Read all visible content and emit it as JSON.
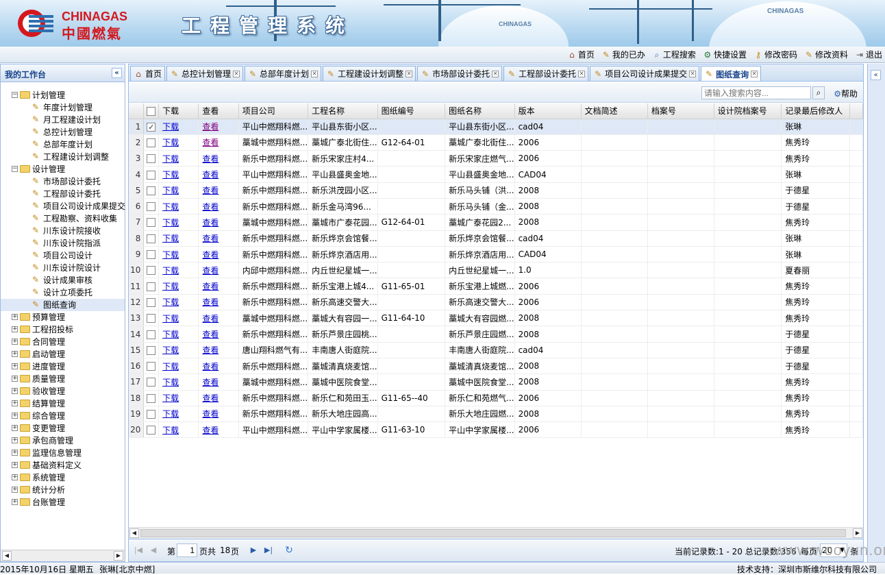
{
  "brand": {
    "logo_en": "CHINAGAS",
    "logo_cn": "中國燃氣",
    "system_title": "工程管理系统",
    "banner_tank_labels": [
      "CHINAGAS",
      "CHINAGAS"
    ]
  },
  "toplinks": [
    {
      "label": "首页",
      "icon": "home-icon"
    },
    {
      "label": "我的已办",
      "icon": "pencil-icon"
    },
    {
      "label": "工程搜索",
      "icon": "search-doc-icon"
    },
    {
      "label": "快捷设置",
      "icon": "gear-icon"
    },
    {
      "label": "修改密码",
      "icon": "key-icon"
    },
    {
      "label": "修改资料",
      "icon": "pencil-icon"
    },
    {
      "label": "退出",
      "icon": "exit-icon"
    }
  ],
  "sidebar": {
    "title": "我的工作台",
    "tree": [
      {
        "label": "计划管理",
        "type": "folder",
        "expanded": true,
        "level": 0
      },
      {
        "label": "年度计划管理",
        "type": "leaf",
        "level": 1
      },
      {
        "label": "月工程建设计划",
        "type": "leaf",
        "level": 1
      },
      {
        "label": "总控计划管理",
        "type": "leaf",
        "level": 1
      },
      {
        "label": "总部年度计划",
        "type": "leaf",
        "level": 1
      },
      {
        "label": "工程建设计划调整",
        "type": "leaf",
        "level": 1
      },
      {
        "label": "设计管理",
        "type": "folder",
        "expanded": true,
        "level": 0
      },
      {
        "label": "市场部设计委托",
        "type": "leaf",
        "level": 1
      },
      {
        "label": "工程部设计委托",
        "type": "leaf",
        "level": 1
      },
      {
        "label": "项目公司设计成果提交",
        "type": "leaf",
        "level": 1
      },
      {
        "label": "工程勘察、资料收集",
        "type": "leaf",
        "level": 1
      },
      {
        "label": "川东设计院接收",
        "type": "leaf",
        "level": 1
      },
      {
        "label": "川东设计院指派",
        "type": "leaf",
        "level": 1
      },
      {
        "label": "项目公司设计",
        "type": "leaf",
        "level": 1
      },
      {
        "label": "川东设计院设计",
        "type": "leaf",
        "level": 1
      },
      {
        "label": "设计成果审核",
        "type": "leaf",
        "level": 1
      },
      {
        "label": "设计立项委托",
        "type": "leaf",
        "level": 1
      },
      {
        "label": "图纸查询",
        "type": "leaf",
        "level": 1,
        "selected": true
      },
      {
        "label": "预算管理",
        "type": "folder",
        "level": 0
      },
      {
        "label": "工程招投标",
        "type": "folder",
        "level": 0
      },
      {
        "label": "合同管理",
        "type": "folder",
        "level": 0
      },
      {
        "label": "启动管理",
        "type": "folder",
        "level": 0
      },
      {
        "label": "进度管理",
        "type": "folder",
        "level": 0
      },
      {
        "label": "质量管理",
        "type": "folder",
        "level": 0
      },
      {
        "label": "验收管理",
        "type": "folder",
        "level": 0
      },
      {
        "label": "结算管理",
        "type": "folder",
        "level": 0
      },
      {
        "label": "综合管理",
        "type": "folder",
        "level": 0
      },
      {
        "label": "变更管理",
        "type": "folder",
        "level": 0
      },
      {
        "label": "承包商管理",
        "type": "folder",
        "level": 0
      },
      {
        "label": "监理信息管理",
        "type": "folder",
        "level": 0
      },
      {
        "label": "基础资料定义",
        "type": "folder",
        "level": 0
      },
      {
        "label": "系统管理",
        "type": "folder",
        "level": 0
      },
      {
        "label": "统计分析",
        "type": "folder",
        "level": 0
      },
      {
        "label": "台账管理",
        "type": "folder",
        "level": 0
      }
    ]
  },
  "tabs": [
    {
      "label": "首页",
      "icon": "home-icon",
      "closable": false
    },
    {
      "label": "总控计划管理",
      "icon": "pencil-icon",
      "closable": true
    },
    {
      "label": "总部年度计划",
      "icon": "pencil-icon",
      "closable": true
    },
    {
      "label": "工程建设计划调整",
      "icon": "pencil-icon",
      "closable": true
    },
    {
      "label": "市场部设计委托",
      "icon": "pencil-icon",
      "closable": true
    },
    {
      "label": "工程部设计委托",
      "icon": "pencil-icon",
      "closable": true
    },
    {
      "label": "项目公司设计成果提交",
      "icon": "pencil-icon",
      "closable": true
    },
    {
      "label": "图纸查询",
      "icon": "pencil-icon",
      "closable": true,
      "active": true
    }
  ],
  "toolbar": {
    "search_placeholder": "请输入搜索内容...",
    "help_label": "帮助"
  },
  "grid": {
    "columns": [
      "下载",
      "查看",
      "项目公司",
      "工程名称",
      "图纸编号",
      "图纸名称",
      "版本",
      "文档简述",
      "档案号",
      "设计院档案号",
      "记录最后修改人"
    ],
    "link_download": "下载",
    "link_view": "查看",
    "rows": [
      {
        "n": "1",
        "checked": true,
        "selected": true,
        "view_visited": true,
        "company": "平山中燃翔科燃...",
        "project": "平山县东街小区...",
        "code": "",
        "drawing": "平山县东街小区...",
        "version": "cad04",
        "desc": "",
        "archive": "",
        "design_archive": "",
        "modifier": "张琳"
      },
      {
        "n": "2",
        "view_visited": true,
        "company": "藁城中燃翔科燃...",
        "project": "藁城广泰北街住...",
        "code": "G12-64-01",
        "drawing": "藁城广泰北街住...",
        "version": "2006",
        "desc": "",
        "archive": "",
        "design_archive": "",
        "modifier": "焦秀玲"
      },
      {
        "n": "3",
        "company": "新乐中燃翔科燃...",
        "project": "新乐宋家庄村4...",
        "code": "",
        "drawing": "新乐宋家庄燃气...",
        "version": "2006",
        "desc": "",
        "archive": "",
        "design_archive": "",
        "modifier": "焦秀玲"
      },
      {
        "n": "4",
        "company": "平山中燃翔科燃...",
        "project": "平山县盛奥金地...",
        "code": "",
        "drawing": "平山县盛奥金地...",
        "version": "CAD04",
        "desc": "",
        "archive": "",
        "design_archive": "",
        "modifier": "张琳"
      },
      {
        "n": "5",
        "company": "新乐中燃翔科燃...",
        "project": "新乐洪茂园小区...",
        "code": "",
        "drawing": "新乐马头铺（洪...",
        "version": "2008",
        "desc": "",
        "archive": "",
        "design_archive": "",
        "modifier": "于德星"
      },
      {
        "n": "6",
        "company": "新乐中燃翔科燃...",
        "project": "新乐金马湾96...",
        "code": "",
        "drawing": "新乐马头铺（金...",
        "version": "2008",
        "desc": "",
        "archive": "",
        "design_archive": "",
        "modifier": "于德星"
      },
      {
        "n": "7",
        "company": "藁城中燃翔科燃...",
        "project": "藁城市广泰花园...",
        "code": "G12-64-01",
        "drawing": "藁城广泰花园2...",
        "version": "2008",
        "desc": "",
        "archive": "",
        "design_archive": "",
        "modifier": "焦秀玲"
      },
      {
        "n": "8",
        "company": "新乐中燃翔科燃...",
        "project": "新乐烨京会馆餐...",
        "code": "",
        "drawing": "新乐烨京会馆餐...",
        "version": "cad04",
        "desc": "",
        "archive": "",
        "design_archive": "",
        "modifier": "张琳"
      },
      {
        "n": "9",
        "company": "新乐中燃翔科燃...",
        "project": "新乐烨京酒店用...",
        "code": "",
        "drawing": "新乐烨京酒店用...",
        "version": "CAD04",
        "desc": "",
        "archive": "",
        "design_archive": "",
        "modifier": "张琳"
      },
      {
        "n": "10",
        "company": "内邱中燃翔科燃...",
        "project": "内丘世纪星城一...",
        "code": "",
        "drawing": "内丘世纪星城一...",
        "version": "1.0",
        "desc": "",
        "archive": "",
        "design_archive": "",
        "modifier": "夏春丽"
      },
      {
        "n": "11",
        "company": "新乐中燃翔科燃...",
        "project": "新乐宝港上城4...",
        "code": "G11-65-01",
        "drawing": "新乐宝港上城燃...",
        "version": "2006",
        "desc": "",
        "archive": "",
        "design_archive": "",
        "modifier": "焦秀玲"
      },
      {
        "n": "12",
        "company": "新乐中燃翔科燃...",
        "project": "新乐高速交警大...",
        "code": "",
        "drawing": "新乐高速交警大...",
        "version": "2006",
        "desc": "",
        "archive": "",
        "design_archive": "",
        "modifier": "焦秀玲"
      },
      {
        "n": "13",
        "company": "藁城中燃翔科燃...",
        "project": "藁城大有容园一...",
        "code": "G11-64-10",
        "drawing": "藁城大有容园燃...",
        "version": "2008",
        "desc": "",
        "archive": "",
        "design_archive": "",
        "modifier": "焦秀玲"
      },
      {
        "n": "14",
        "company": "新乐中燃翔科燃...",
        "project": "新乐芦景庄园桃...",
        "code": "",
        "drawing": "新乐芦景庄园燃...",
        "version": "2008",
        "desc": "",
        "archive": "",
        "design_archive": "",
        "modifier": "于德星"
      },
      {
        "n": "15",
        "company": "唐山翔科燃气有...",
        "project": "丰南唐人街庭院...",
        "code": "",
        "drawing": "丰南唐人街庭院...",
        "version": "cad04",
        "desc": "",
        "archive": "",
        "design_archive": "",
        "modifier": "于德星"
      },
      {
        "n": "16",
        "company": "新乐中燃翔科燃...",
        "project": "藁城清真烧麦馆...",
        "code": "",
        "drawing": "藁城清真烧麦馆...",
        "version": "2008",
        "desc": "",
        "archive": "",
        "design_archive": "",
        "modifier": "于德星"
      },
      {
        "n": "17",
        "company": "藁城中燃翔科燃...",
        "project": "藁城中医院食堂...",
        "code": "",
        "drawing": "藁城中医院食堂...",
        "version": "2008",
        "desc": "",
        "archive": "",
        "design_archive": "",
        "modifier": "焦秀玲"
      },
      {
        "n": "18",
        "company": "新乐中燃翔科燃...",
        "project": "新乐仁和苑田玉...",
        "code": "G11-65--40",
        "drawing": "新乐仁和苑燃气...",
        "version": "2006",
        "desc": "",
        "archive": "",
        "design_archive": "",
        "modifier": "焦秀玲"
      },
      {
        "n": "19",
        "company": "新乐中燃翔科燃...",
        "project": "新乐大地庄园高...",
        "code": "",
        "drawing": "新乐大地庄园燃...",
        "version": "2008",
        "desc": "",
        "archive": "",
        "design_archive": "",
        "modifier": "焦秀玲"
      },
      {
        "n": "20",
        "company": "平山中燃翔科燃...",
        "project": "平山中学家属楼...",
        "code": "G11-63-10",
        "drawing": "平山中学家属楼...",
        "version": "2006",
        "desc": "",
        "archive": "",
        "design_archive": "",
        "modifier": "焦秀玲"
      }
    ]
  },
  "pager": {
    "page_prefix": "第",
    "page_value": "1",
    "page_suffix": "页共",
    "total_pages": "18",
    "page_unit": "页",
    "record_info": "当前记录数:1 - 20 总记录数:356",
    "page_size_label": "每页",
    "page_size": "20",
    "page_size_unit": "条"
  },
  "status": {
    "date": "2015年10月16日 星期五",
    "user": "张琳[北京中燃]",
    "support": "技术支持：深圳市斯维尔科技有限公司"
  },
  "watermark": "www.wooyun.org",
  "colors": {
    "brand_red": "#d4181e",
    "link": "#0000cc",
    "visited_link": "#800080",
    "panel_border": "#99bbe8",
    "header_text": "#15428b"
  }
}
